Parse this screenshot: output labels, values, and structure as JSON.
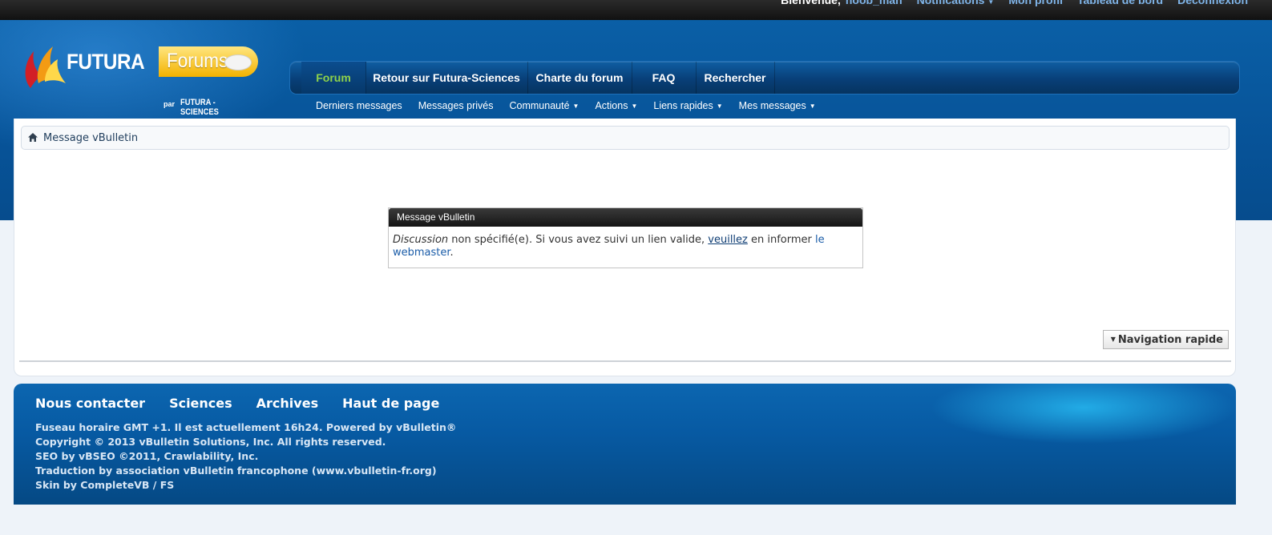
{
  "topbar": {
    "welcome": "Bienvenue,",
    "username": "noob_man",
    "links": [
      "Notifications",
      "Mon profil",
      "Tableau de bord",
      "Déconnexion"
    ]
  },
  "logo": {
    "futura": "FUTURA",
    "forums": "Forums",
    "par": "par",
    "futura_sciences": "FUTURA - SCIENCES"
  },
  "nav": {
    "tabs": [
      "Forum",
      "Retour sur Futura-Sciences",
      "Charte du forum",
      "FAQ",
      "Rechercher"
    ],
    "active_tab": "Forum",
    "subnav": [
      "Derniers messages",
      "Messages privés",
      "Communauté",
      "Actions",
      "Liens rapides",
      "Mes messages"
    ]
  },
  "breadcrumb": {
    "current": "Message vBulletin"
  },
  "message": {
    "title": "Message vBulletin",
    "word_discussion": "Discussion",
    "text_a": " non spécifié(e). Si vous avez suivi un lien valide, ",
    "link_veuillez": "veuillez",
    "text_b": " en informer ",
    "link_webmaster": "le webmaster",
    "text_end": "."
  },
  "quick_nav": {
    "label": "Navigation rapide"
  },
  "footer": {
    "links": [
      "Nous contacter",
      "Sciences",
      "Archives",
      "Haut de page"
    ],
    "lines": [
      "Fuseau horaire GMT +1. Il est actuellement 16h24. Powered by vBulletin®",
      "Copyright © 2013 vBulletin Solutions, Inc. All rights reserved.",
      "SEO by vBSEO ©2011, Crawlability, Inc.",
      "Traduction by association vBulletin francophone (www.vbulletin-fr.org)",
      "Skin by CompleteVB / FS"
    ]
  },
  "colors": {
    "header_blue": "#075398",
    "active_tab_green": "#8fd24a",
    "footer_blue": "#075aa3",
    "link_blue": "#1a5ca8"
  }
}
